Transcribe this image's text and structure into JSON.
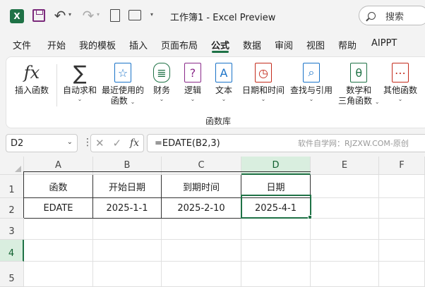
{
  "titlebar": {
    "app_icon": "excel-icon",
    "title": "工作簿1  -  Excel Preview",
    "search_placeholder": "搜索"
  },
  "menu": {
    "tabs": [
      "文件",
      "开始",
      "我的模板",
      "插入",
      "页面布局",
      "公式",
      "数据",
      "审阅",
      "视图",
      "帮助",
      "AIPPT"
    ],
    "active": "公式"
  },
  "ribbon": {
    "insert_function": "插入函数",
    "autosum": "自动求和",
    "recent_1": "最近使用的",
    "recent_2": "函数",
    "financial": "财务",
    "logical": "逻辑",
    "text": "文本",
    "datetime": "日期和时间",
    "lookup": "查找与引用",
    "math_1": "数学和",
    "math_2": "三角函数",
    "more": "其他函数",
    "group_label": "函数库"
  },
  "formula_bar": {
    "name_box": "D2",
    "formula": "=EDATE(B2,3)",
    "fx": "fx"
  },
  "watermark": "软件自学网：RJZXW.COM-原创",
  "sheet": {
    "columns": [
      "A",
      "B",
      "C",
      "D",
      "E",
      "F"
    ],
    "rows": [
      "1",
      "2",
      "3",
      "4",
      "5"
    ],
    "cells": {
      "A1": "函数",
      "B1": "开始日期",
      "C1": "到期时间",
      "D1": "日期",
      "A2": "EDATE",
      "B2": "2025-1-1",
      "C2": "2025-2-10",
      "D2": "2025-4-1"
    },
    "selected_cell": "D2"
  },
  "colors": {
    "accent": "#1f7246",
    "selection_header": "#d9eedf"
  }
}
